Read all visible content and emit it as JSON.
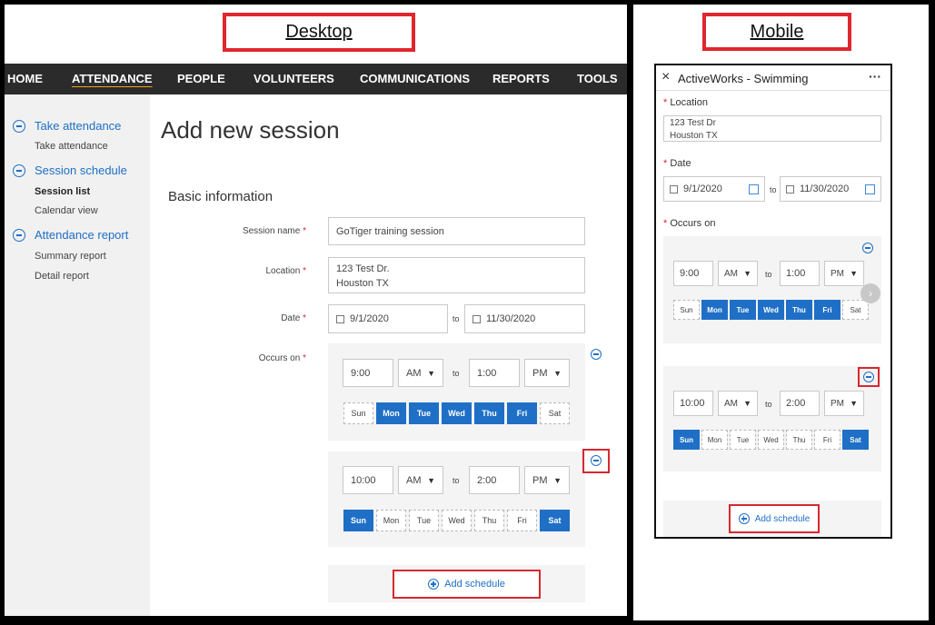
{
  "labels": {
    "desktop": "Desktop",
    "mobile": "Mobile"
  },
  "desktop": {
    "nav": [
      "HOME",
      "ATTENDANCE",
      "PEOPLE",
      "VOLUNTEERS",
      "COMMUNICATIONS",
      "REPORTS",
      "TOOLS"
    ],
    "sidebar": {
      "take_attendance": "Take attendance",
      "take_attendance_sub": "Take attendance",
      "session_schedule": "Session schedule",
      "session_list": "Session list",
      "calendar_view": "Calendar view",
      "attendance_report": "Attendance report",
      "summary_report": "Summary report",
      "detail_report": "Detail report"
    },
    "title": "Add new session",
    "section": "Basic information",
    "fields": {
      "session_name_label": "Session name",
      "session_name": "GoTiger training session",
      "location_label": "Location",
      "location_line1": "123 Test Dr.",
      "location_line2": "Houston TX",
      "date_label": "Date",
      "date_from": "9/1/2020",
      "date_to": "11/30/2020",
      "to": "to",
      "occurs_label": "Occurs on",
      "required": "*"
    },
    "schedules": [
      {
        "start": "9:00",
        "start_ampm": "AM",
        "end": "1:00",
        "end_ampm": "PM"
      },
      {
        "start": "10:00",
        "start_ampm": "AM",
        "end": "2:00",
        "end_ampm": "PM"
      }
    ],
    "days": [
      "Sun",
      "Mon",
      "Tue",
      "Wed",
      "Thu",
      "Fri",
      "Sat"
    ],
    "add_schedule": "Add schedule"
  },
  "mobile": {
    "header_title": "ActiveWorks - Swimming",
    "close": "×",
    "more": "···",
    "location_label": "Location",
    "location_line1": "123 Test Dr",
    "location_line2": "Houston TX",
    "date_label": "Date",
    "date_from": "9/1/2020",
    "date_to": "11/30/2020",
    "to": "to",
    "occurs_label": "Occurs on",
    "required": "*",
    "schedules": [
      {
        "start": "9:00",
        "start_ampm": "AM",
        "end": "1:00",
        "end_ampm": "PM"
      },
      {
        "start": "10:00",
        "start_ampm": "AM",
        "end": "2:00",
        "end_ampm": "PM"
      }
    ],
    "days": [
      "Sun",
      "Mon",
      "Tue",
      "Wed",
      "Thu",
      "Fri",
      "Sat"
    ],
    "add_schedule": "Add schedule"
  },
  "colors": {
    "accent": "#1f6fc6",
    "highlight": "#d7282f",
    "nav_bg": "#2b2b2b",
    "nav_underline": "#f0a32a"
  }
}
